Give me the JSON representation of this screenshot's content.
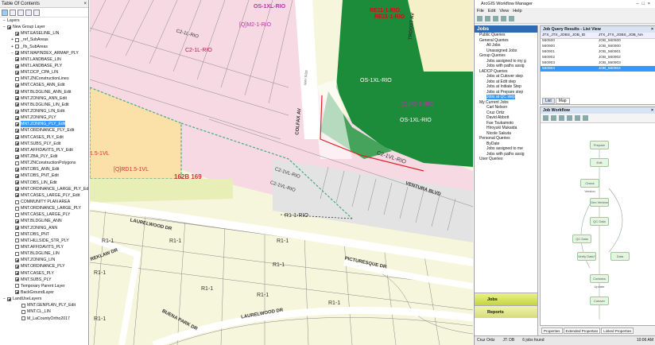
{
  "toc": {
    "title": "Table Of Contents",
    "close": "×",
    "root": "Layers",
    "layers": [
      {
        "label": "New Group Layer",
        "checked": true,
        "level": 0,
        "expander": "−"
      },
      {
        "label": "MNT.EASELINE_LIN",
        "checked": true,
        "level": 1,
        "expander": ""
      },
      {
        "label": "_ref_SubAreas",
        "checked": false,
        "level": 1,
        "expander": "+"
      },
      {
        "label": "_Ifs_SubAreas",
        "checked": false,
        "level": 1,
        "expander": "+"
      },
      {
        "label": "MNT.MAPINDEX_ARMAP_PLY",
        "checked": true,
        "level": 1,
        "expander": "−"
      },
      {
        "label": "MNT.LANDBASE_LIN",
        "checked": true,
        "level": 1,
        "expander": ""
      },
      {
        "label": "MNT.LANDBASE_PLY",
        "checked": true,
        "level": 1,
        "expander": ""
      },
      {
        "label": "MNT.DCP_CPA_LIN",
        "checked": true,
        "level": 1,
        "expander": ""
      },
      {
        "label": "MNT.ZNConstructionLines",
        "checked": false,
        "level": 1,
        "expander": ""
      },
      {
        "label": "MNT.CASES_ANN_Edit",
        "checked": true,
        "level": 1,
        "expander": ""
      },
      {
        "label": "MNT.BLDGLINE_ANN_Edit",
        "checked": true,
        "level": 1,
        "expander": ""
      },
      {
        "label": "MNT.ZONING_ANN_Edit",
        "checked": true,
        "level": 1,
        "expander": ""
      },
      {
        "label": "MNT.BLDGLINE_LIN_Edit",
        "checked": true,
        "level": 1,
        "expander": ""
      },
      {
        "label": "MNT.ZONING_LIN_Edit",
        "checked": true,
        "level": 1,
        "expander": ""
      },
      {
        "label": "MNT.ZONING_PLY",
        "checked": true,
        "level": 1,
        "expander": ""
      },
      {
        "label": "MNT.ZONING_PLY_Edit",
        "checked": true,
        "level": 1,
        "expander": "",
        "selected": true
      },
      {
        "label": "MNT.ORDINANCE_PLY_Edit",
        "checked": true,
        "level": 1,
        "expander": ""
      },
      {
        "label": "MNT.CASES_PLY_Edit",
        "checked": true,
        "level": 1,
        "expander": ""
      },
      {
        "label": "MNT.SUBS_PLY_Edit",
        "checked": true,
        "level": 1,
        "expander": ""
      },
      {
        "label": "MNT.AFFIDAVITS_PLY_Edit",
        "checked": true,
        "level": 1,
        "expander": ""
      },
      {
        "label": "MNT.ZBA_PLY_Edit",
        "checked": true,
        "level": 1,
        "expander": ""
      },
      {
        "label": "MNT.ZNConstructionPolygons",
        "checked": false,
        "level": 1,
        "expander": ""
      },
      {
        "label": "MNT.DBS_ANN_Edit",
        "checked": true,
        "level": 1,
        "expander": ""
      },
      {
        "label": "MNT.DBS_PNT_Edit",
        "checked": true,
        "level": 1,
        "expander": ""
      },
      {
        "label": "MNT.DBS_LIN_Edit",
        "checked": true,
        "level": 1,
        "expander": ""
      },
      {
        "label": "MNT.ORDINANCE_LARGE_PLY_Edit",
        "checked": true,
        "level": 1,
        "expander": ""
      },
      {
        "label": "MNT.CASES_LARGE_PLY_Edit",
        "checked": true,
        "level": 1,
        "expander": ""
      },
      {
        "label": "COMMUNITY PLAN AREA",
        "checked": false,
        "level": 1,
        "expander": ""
      },
      {
        "label": "MNT.ORDINANCE_LARGE_PLY",
        "checked": false,
        "level": 1,
        "expander": ""
      },
      {
        "label": "MNT.CASES_LARGE_PLY",
        "checked": false,
        "level": 1,
        "expander": ""
      },
      {
        "label": "MNT.BLDGLINE_ANN",
        "checked": true,
        "level": 1,
        "expander": ""
      },
      {
        "label": "MNT.ZONING_ANN",
        "checked": true,
        "level": 1,
        "expander": ""
      },
      {
        "label": "MNT.DBS_PNT",
        "checked": false,
        "level": 1,
        "expander": ""
      },
      {
        "label": "MNT.HILLSIDE_STR_PLY",
        "checked": false,
        "level": 1,
        "expander": ""
      },
      {
        "label": "MNT.AFFIDAVITS_PLY",
        "checked": false,
        "level": 1,
        "expander": ""
      },
      {
        "label": "MNT.BLDGLINE_LIN",
        "checked": false,
        "level": 1,
        "expander": ""
      },
      {
        "label": "MNT.ZONING_LIN",
        "checked": true,
        "level": 1,
        "expander": ""
      },
      {
        "label": "MNT.ORDINANCE_PLY",
        "checked": true,
        "level": 1,
        "expander": ""
      },
      {
        "label": "MNT.CASES_PLY",
        "checked": true,
        "level": 1,
        "expander": ""
      },
      {
        "label": "MNT.SUBS_PLY",
        "checked": true,
        "level": 1,
        "expander": ""
      },
      {
        "label": "Temporary Parent Layer",
        "checked": false,
        "level": 1,
        "expander": ""
      },
      {
        "label": "BackGroundLayer",
        "checked": true,
        "level": 1,
        "expander": ""
      },
      {
        "label": "LandUseLayers",
        "checked": true,
        "level": 0,
        "expander": "−"
      },
      {
        "label": "MNT.GENPLAN_PLY_Edit",
        "checked": false,
        "level": 2,
        "expander": ""
      },
      {
        "label": "MNT.CL_LIN",
        "checked": false,
        "level": 2,
        "expander": ""
      },
      {
        "label": "M_LaCountyOrtho2017",
        "checked": false,
        "level": 2,
        "expander": ""
      }
    ]
  },
  "map": {
    "labels": {
      "os": "OS-1XL-RIO",
      "re": "RE11-1-RIO",
      "q2": "[Q]M2-1-RIO",
      "c2a": "C2-1L-RIO",
      "c2b": "C2-1L-RIO",
      "os2": "OS-1XL-RIO",
      "os3": "OS-1XL-RIO",
      "q2b": "[Q]M2-1-RIO",
      "colfax": "COLFAX AV",
      "troost": "TROOST AV",
      "c2vl": "C2-1VL-RIO",
      "c2vl2": "C2-1VL-RIO",
      "c2vl3": "C2-1VL-RIO",
      "ventura": "VENTURA BLVD",
      "qrd": "[Q]RD1.5-1VL",
      "q15": "1.5-1VL",
      "b169": "162B 169",
      "r11rio": "R1-1-RIO",
      "laurel1": "LAURELWOOD DR",
      "laurel2": "LAURELWOOD DR",
      "picturesque": "PICTURESQUE DR",
      "buena": "BUENA PARK DR",
      "breklaw": "REKLAW DR",
      "r1a": "R1-1",
      "r1b": "R1-1",
      "r1c": "R1-1",
      "r1d": "R1-1",
      "r1e": "R1-1",
      "r1f": "R1-1",
      "r1g": "R1-1",
      "r1h": "R1-1",
      "r1i": "R1-1",
      "wayside": "WAY SIDE"
    }
  },
  "wmx": {
    "title": "ArcGIS Workflow Manager",
    "menu": [
      "File",
      "Edit",
      "View",
      "Help"
    ],
    "jobs_header": "Jobs",
    "queries": [
      {
        "label": "Public Queries",
        "type": "grp"
      },
      {
        "label": "General Queries",
        "type": "grp"
      },
      {
        "label": "All Jobs",
        "type": "item"
      },
      {
        "label": "Unassigned Jobs",
        "type": "item"
      },
      {
        "label": "Group Queries",
        "type": "grp"
      },
      {
        "label": "Jobs assigned to my g",
        "type": "item"
      },
      {
        "label": "Jobs with paths assig",
        "type": "item"
      },
      {
        "label": "LADCP Queries",
        "type": "grp"
      },
      {
        "label": "Jobs at Cutover step",
        "type": "item"
      },
      {
        "label": "Jobs at Edit step",
        "type": "item"
      },
      {
        "label": "Jobs at Initiate Step",
        "type": "item"
      },
      {
        "label": "Jobs at Prepare step",
        "type": "item"
      },
      {
        "label": "Jobs at QC step",
        "type": "item",
        "selected": true
      },
      {
        "label": "My Current Jobs",
        "type": "grp"
      },
      {
        "label": "Carl Nelson",
        "type": "item"
      },
      {
        "label": "Cruz Ortiz",
        "type": "item"
      },
      {
        "label": "David Abbott",
        "type": "item"
      },
      {
        "label": "Fae Tsukamoto",
        "type": "item"
      },
      {
        "label": "Hiroyuki Mukaida",
        "type": "item"
      },
      {
        "label": "Nicole Sakuta",
        "type": "item"
      },
      {
        "label": "Personal Queries",
        "type": "grp"
      },
      {
        "label": "ByDate",
        "type": "item"
      },
      {
        "label": "Jobs assigned to me",
        "type": "item"
      },
      {
        "label": "Jobs with paths assig",
        "type": "item"
      },
      {
        "label": "User Queries",
        "type": "grp"
      }
    ],
    "btn_jobs": "Jobs",
    "btn_reports": "Reports",
    "results_header": "Job Query Results - List View",
    "results_cols": [
      "JTX_JTX_JOBS_JOB_ID",
      "JTX_JTX_JOBS_JOB_NA"
    ],
    "results_rows": [
      [
        "560500",
        "JOB_560500"
      ],
      [
        "560900",
        "JOB_560900"
      ],
      [
        "560901",
        "JOB_560901"
      ],
      [
        "560902",
        "JOB_560902"
      ],
      [
        "560903",
        "JOB_560903"
      ],
      [
        "560904",
        "JOB_560904"
      ]
    ],
    "result_tabs": [
      "List",
      "Map"
    ],
    "workflow_header": "Job Workflow",
    "wf_steps": [
      "Prepare",
      "Edit",
      "Check Version",
      "Geo Version",
      "QC Data",
      "QC Data",
      "Verify Data?",
      "Data",
      "Contains Update",
      "Cutover"
    ],
    "bottom_tabs": [
      "Properties",
      "Extended Properties",
      "Linked Properties"
    ],
    "status_user": "Cruz Ortiz",
    "status_jt": "JT: DB",
    "status_count": "6 jobs found",
    "status_time": "10:06 AM"
  }
}
